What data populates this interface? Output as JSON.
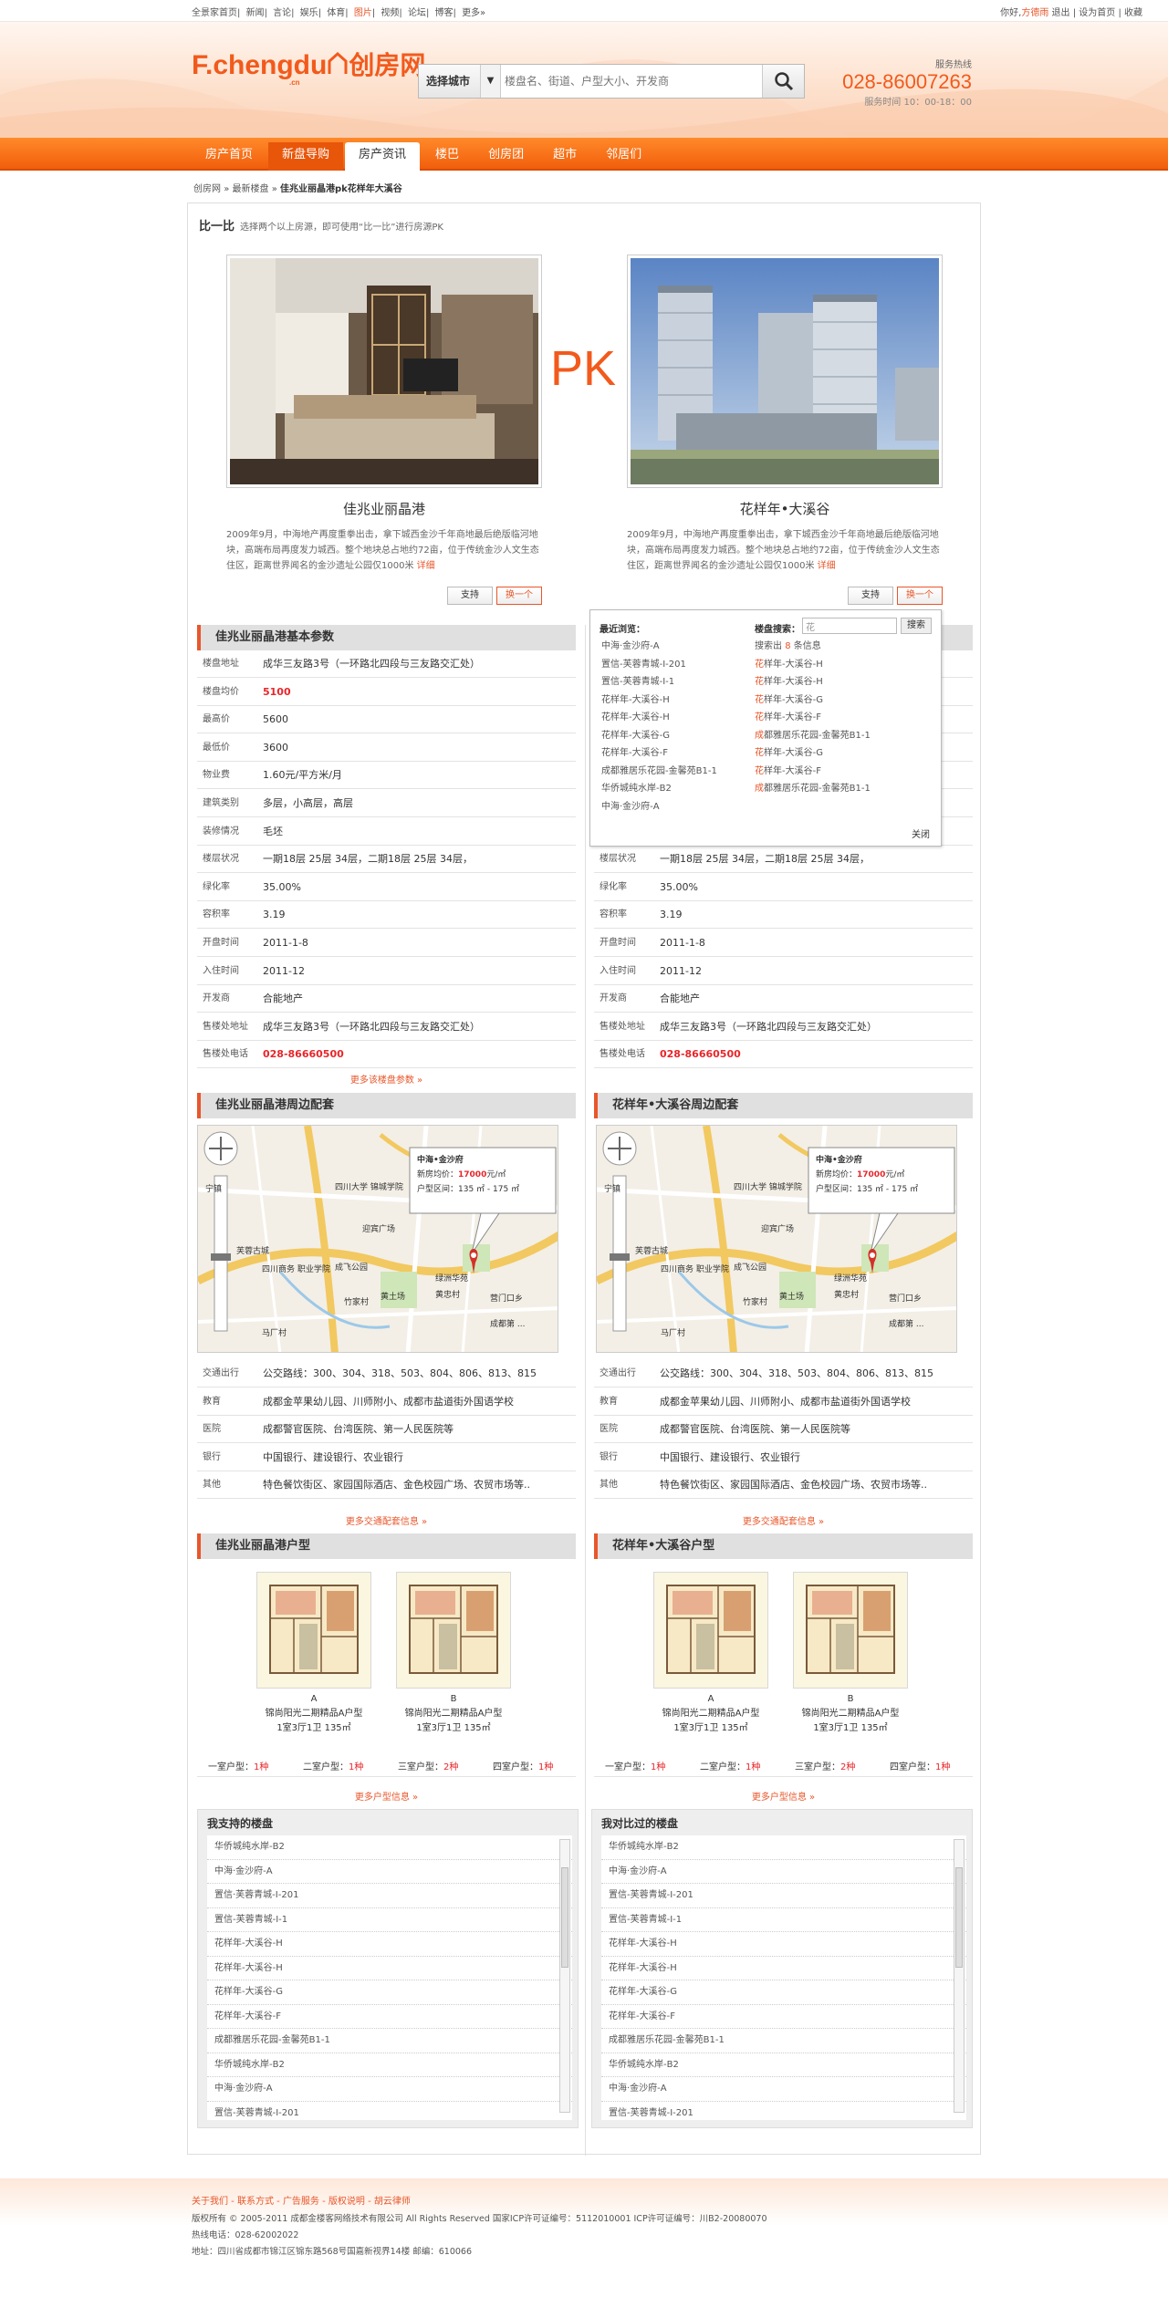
{
  "topbar": {
    "links": [
      "全景家首页",
      "新闻",
      "言论",
      "娱乐",
      "体育",
      "图片",
      "视频",
      "论坛",
      "博客",
      "更多»"
    ],
    "greeting": "你好,",
    "user": "方德雨",
    "logout": "退出",
    "set_home": "设为首页",
    "bookmark": "收藏"
  },
  "header": {
    "logo_en": "F.chengdu",
    "logo_cn": "创房网",
    "logo_sub": ".cn",
    "search_city": "选择城市",
    "search_placeholder": "楼盘名、街道、户型大小、开发商",
    "hotline_label": "服务热线",
    "hotline": "028-86007263",
    "hotline_time": "服务时间 10：00-18：00"
  },
  "nav": [
    "房产首页",
    "新盘导购",
    "房产资讯",
    "楼巴",
    "创房团",
    "超市",
    "邻居们"
  ],
  "breadcrumb": {
    "a": "创房网",
    "b": "最新楼盘",
    "c": "佳兆业丽晶港pk花样年大溪谷",
    "sep": "»"
  },
  "compare": {
    "title": "比一比",
    "hint": "选择两个以上房源，即可使用“比一比”进行房源PK",
    "pk": "PK"
  },
  "left": {
    "name": "佳兆业丽晶港",
    "desc": "2009年9月，中海地产再度重拳出击，拿下城西金沙千年商地最后绝版临河地块，高端布局再度发力城西。整个地块总占地约72亩，位于传统金沙人文生态住区，距离世界闻名的金沙遗址公园仅1000米",
    "more": "详细",
    "support": "支持",
    "change": "换一个",
    "basic_title": "佳兆业丽晶港基本参数",
    "around_title": "佳兆业丽晶港周边配套",
    "unit_title": "佳兆业丽晶港户型"
  },
  "right": {
    "name": "花样年•大溪谷",
    "desc": "2009年9月，中海地产再度重拳出击，拿下城西金沙千年商地最后绝版临河地块，高端布局再度发力城西。整个地块总占地约72亩，位于传统金沙人文生态住区，距离世界闻名的金沙遗址公园仅1000米",
    "more": "详细",
    "support": "支持",
    "change": "换一个",
    "around_title": "花样年•大溪谷周边配套",
    "unit_title": "花样年•大溪谷户型"
  },
  "params": [
    {
      "k": "楼盘地址",
      "l": "成华三友路3号（一环路北四段与三友路交汇处）",
      "r": ""
    },
    {
      "k": "楼盘均价",
      "l": "5100",
      "r": "",
      "red": true
    },
    {
      "k": "最高价",
      "l": "5600",
      "r": ""
    },
    {
      "k": "最低价",
      "l": "3600",
      "r": ""
    },
    {
      "k": "物业费",
      "l": "1.60元/平方米/月",
      "r": ""
    },
    {
      "k": "建筑类别",
      "l": "多层，小高层，高层",
      "r": ""
    },
    {
      "k": "装修情况",
      "l": "毛坯",
      "r": "毛坯"
    },
    {
      "k": "楼层状况",
      "l": "一期18层 25层 34层，二期18层 25层 34层，",
      "r": "一期18层 25层 34层，二期18层 25层 34层，"
    },
    {
      "k": "绿化率",
      "l": "35.00%",
      "r": "35.00%"
    },
    {
      "k": "容积率",
      "l": "3.19",
      "r": "3.19"
    },
    {
      "k": "开盘时间",
      "l": "2011-1-8",
      "r": "2011-1-8"
    },
    {
      "k": "入住时间",
      "l": "2011-12",
      "r": "2011-12"
    },
    {
      "k": "开发商",
      "l": "合能地产",
      "r": "合能地产"
    },
    {
      "k": "售楼处地址",
      "l": "成华三友路3号（一环路北四段与三友路交汇处）",
      "r": "成华三友路3号（一环路北四段与三友路交汇处）"
    },
    {
      "k": "售楼处电话",
      "l": "028-86660500",
      "r": "028-86660500",
      "red": true
    }
  ],
  "more_params": "更多该楼盘参数 »",
  "map": {
    "name": "中海•金沙府",
    "price_label": "新房均价：",
    "price": "17000",
    "price_unit": "元/㎡",
    "area_label": "户型区间：",
    "area": "135 ㎡ - 175 ㎡",
    "labels": [
      "宁镇",
      "芙蓉古城",
      "四川大学 锦城学院",
      "四川商务 职业学院",
      "成飞公园",
      "迎宾广场",
      "竹家村",
      "黄土场",
      "马厂村",
      "绿洲华苑",
      "黄忠村",
      "营门口乡",
      "成都第 ..."
    ]
  },
  "around": [
    {
      "k": "交通出行",
      "v": "公交路线：300、304、318、503、804、806、813、815"
    },
    {
      "k": "教育",
      "v": "成都金苹果幼儿园、川师附小、成都市盐道街外国语学校"
    },
    {
      "k": "医院",
      "v": "成都警官医院、台湾医院、第一人民医院等"
    },
    {
      "k": "银行",
      "v": "中国银行、建设银行、农业银行"
    },
    {
      "k": "其他",
      "v": "特色餐饮街区、家园国际酒店、金色校园广场、农贸市场等.."
    }
  ],
  "more_around": "更多交通配套信息 »",
  "units": [
    {
      "letter": "A",
      "name": "锦尚阳光二期精品A户型",
      "spec": "1室3厅1卫 135㎡"
    },
    {
      "letter": "B",
      "name": "锦尚阳光二期精品A户型",
      "spec": "1室3厅1卫 135㎡"
    }
  ],
  "unit_counts": [
    {
      "k": "一室户型：",
      "v": "1种"
    },
    {
      "k": "二室户型：",
      "v": "1种"
    },
    {
      "k": "三室户型：",
      "v": "2种"
    },
    {
      "k": "四室户型：",
      "v": "1种"
    }
  ],
  "more_units": "更多户型信息 »",
  "supported": {
    "title": "我支持的楼盘",
    "items": [
      "华侨城纯水岸-B2",
      "中海·金沙府-A",
      "置信·芙蓉青城-I-201",
      "置信-芙蓉青城-I-1",
      "花样年-大溪谷-H",
      "花样年-大溪谷-H",
      "花样年-大溪谷-G",
      "花样年-大溪谷-F",
      "成都雅居乐花园-金馨苑B1-1",
      "华侨城纯水岸-B2",
      "中海·金沙府-A",
      "置信-芙蓉青城-I-201"
    ]
  },
  "compared": {
    "title": "我对比过的楼盘",
    "items": [
      "华侨城纯水岸-B2",
      "中海·金沙府-A",
      "置信-芙蓉青城-I-201",
      "置信-芙蓉青城-I-1",
      "花样年-大溪谷-H",
      "花样年-大溪谷-H",
      "花样年-大溪谷-G",
      "花样年-大溪谷-F",
      "成都雅居乐花园-金馨苑B1-1",
      "华侨城纯水岸-B2",
      "中海·金沙府-A",
      "置信-芙蓉青城-I-201"
    ]
  },
  "popup": {
    "recent": "最近浏览：",
    "search_label": "楼盘搜索：",
    "search_value": "花",
    "search_btn": "搜索",
    "result_a": "搜索出",
    "result_n": "8",
    "result_b": "条信息",
    "close": "关闭",
    "recent_items": [
      "中海·金沙府-A",
      "置信-芙蓉青城-I-201",
      "置信-芙蓉青城-I-1",
      "花样年-大溪谷-H",
      "花样年-大溪谷-H",
      "花样年-大溪谷-G",
      "花样年-大溪谷-F",
      "成都雅居乐花园-金馨苑B1-1",
      "华侨城纯水岸-B2",
      "中海·金沙府-A"
    ],
    "result_items": [
      "花样年-大溪谷-H",
      "花样年-大溪谷-H",
      "花样年-大溪谷-G",
      "花样年-大溪谷-F",
      "成都雅居乐花园-金馨苑B1-1",
      "花样年-大溪谷-G",
      "花样年-大溪谷-F",
      "成都雅居乐花园-金馨苑B1-1"
    ]
  },
  "footer": {
    "links": [
      "关于我们",
      "联系方式",
      "广告服务",
      "版权说明",
      "胡云律师"
    ],
    "sep": " - ",
    "copyright": "版权所有 © 2005-2011 成都金楼客网络技术有限公司 All Rights Reserved 国家ICP许可证编号：5112010001 ICP许可证编号：川B2-20080070",
    "phone": "热线电话：028-62002022",
    "address": "地址：四川省成都市锦江区锦东路568号国嘉新视界14楼 邮编：610066"
  },
  "colors": {
    "accent": "#f25a1c",
    "nav": "#f6701a",
    "price": "#e8262a"
  }
}
